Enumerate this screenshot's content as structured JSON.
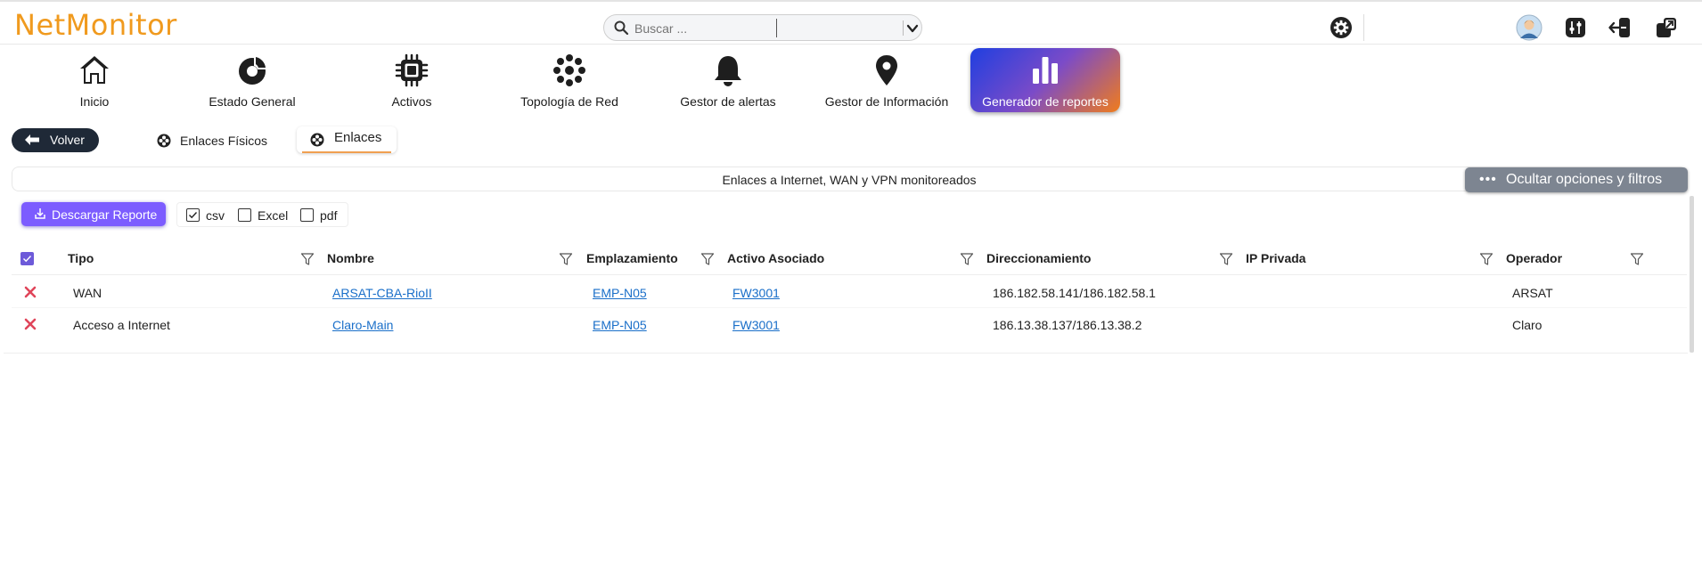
{
  "app": {
    "logo": "NetMonitor"
  },
  "search": {
    "placeholder": "Buscar ..."
  },
  "nav": {
    "items": [
      {
        "label": "Inicio",
        "icon": "home-icon"
      },
      {
        "label": "Estado General",
        "icon": "donut-chart-icon"
      },
      {
        "label": "Activos",
        "icon": "chip-icon"
      },
      {
        "label": "Topología de Red",
        "icon": "network-icon"
      },
      {
        "label": "Gestor de alertas",
        "icon": "bell-icon"
      },
      {
        "label": "Gestor de Información",
        "icon": "map-pin-icon"
      },
      {
        "label": "Generador de reportes",
        "icon": "bar-chart-icon",
        "active": true
      }
    ]
  },
  "subnav": {
    "back_label": "Volver",
    "tabs": [
      {
        "label": "Enlaces Físicos",
        "active": false
      },
      {
        "label": "Enlaces",
        "active": true
      }
    ]
  },
  "panel": {
    "title": "Enlaces a Internet, WAN y VPN monitoreados",
    "toggle_label": "Ocultar opciones y filtros"
  },
  "export": {
    "button_label": "Descargar Reporte",
    "formats": [
      {
        "label": "csv",
        "checked": true
      },
      {
        "label": "Excel",
        "checked": false
      },
      {
        "label": "pdf",
        "checked": false
      }
    ]
  },
  "table": {
    "columns": [
      "Tipo",
      "Nombre",
      "Emplazamiento",
      "Activo Asociado",
      "Direccionamiento",
      "IP Privada",
      "Operador"
    ],
    "rows": [
      {
        "tipo": "WAN",
        "nombre": "ARSAT-CBA-RioII",
        "emplazamiento": "EMP-N05",
        "activo": "FW3001",
        "direccionamiento": "186.182.58.141/186.182.58.1",
        "ip_privada": "",
        "operador": "ARSAT"
      },
      {
        "tipo": "Acceso a Internet",
        "nombre": "Claro-Main",
        "emplazamiento": "EMP-N05",
        "activo": "FW3001",
        "direccionamiento": "186.13.38.137/186.13.38.2",
        "ip_privada": "",
        "operador": "Claro"
      }
    ]
  },
  "colors": {
    "brand": "#f09a1e",
    "accent": "#7c5cff",
    "dark": "#1f2937",
    "delete": "#e0455a"
  }
}
